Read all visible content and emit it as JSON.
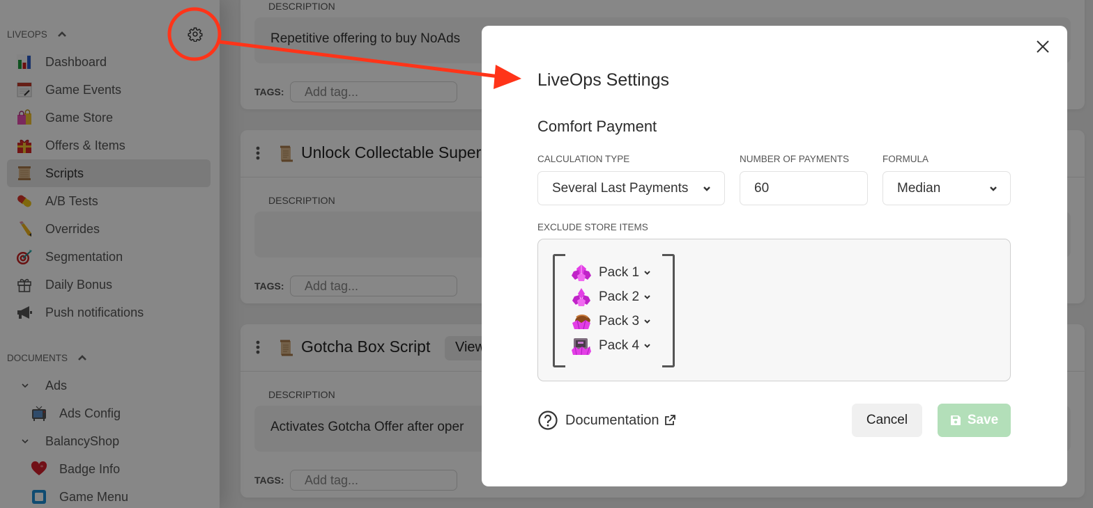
{
  "colors": {
    "annotation": "#ff3419",
    "save_button": "#b3dfb9"
  },
  "sidebar": {
    "liveops": {
      "label": "LIVEOPS",
      "items": [
        {
          "label": "Dashboard",
          "icon": "bar-chart-icon"
        },
        {
          "label": "Game Events",
          "icon": "calendar-icon"
        },
        {
          "label": "Game Store",
          "icon": "shopping-bags-icon"
        },
        {
          "label": "Offers & Items",
          "icon": "gift-icon"
        },
        {
          "label": "Scripts",
          "icon": "scroll-icon",
          "active": true
        },
        {
          "label": "A/B Tests",
          "icon": "pill-icon"
        },
        {
          "label": "Overrides",
          "icon": "pencil-icon"
        },
        {
          "label": "Segmentation",
          "icon": "target-icon"
        },
        {
          "label": "Daily Bonus",
          "icon": "gift-outline-icon"
        },
        {
          "label": "Push notifications",
          "icon": "megaphone-icon"
        }
      ]
    },
    "documents": {
      "label": "DOCUMENTS",
      "groups": [
        {
          "label": "Ads",
          "items": [
            {
              "label": "Ads Config",
              "icon": "tv-icon"
            }
          ]
        },
        {
          "label": "BalancyShop",
          "items": [
            {
              "label": "Badge Info",
              "icon": "heart-icon"
            },
            {
              "label": "Game Menu",
              "icon": "blue-square-icon"
            }
          ]
        }
      ]
    }
  },
  "labels": {
    "description": "DESCRIPTION",
    "tags": "TAGS:",
    "tag_placeholder": "Add tag..."
  },
  "scripts": [
    {
      "title": "",
      "description": "Repetitive offering to buy NoAds"
    },
    {
      "title": "Unlock Collectable Super",
      "description": ""
    },
    {
      "title": "Gotcha Box Script",
      "view_label": "View",
      "description": "Activates Gotcha Offer after oper"
    }
  ],
  "modal": {
    "title": "LiveOps Settings",
    "section": "Comfort Payment",
    "calculation_type": {
      "label": "CALCULATION TYPE",
      "value": "Several Last Payments"
    },
    "number_of_payments": {
      "label": "NUMBER OF PAYMENTS",
      "value": "60"
    },
    "formula": {
      "label": "FORMULA",
      "value": "Median"
    },
    "exclude": {
      "label": "EXCLUDE STORE ITEMS",
      "items": [
        {
          "label": "Pack 1"
        },
        {
          "label": "Pack 2"
        },
        {
          "label": "Pack 3"
        },
        {
          "label": "Pack 4"
        }
      ]
    },
    "documentation": "Documentation",
    "cancel": "Cancel",
    "save": "Save"
  }
}
